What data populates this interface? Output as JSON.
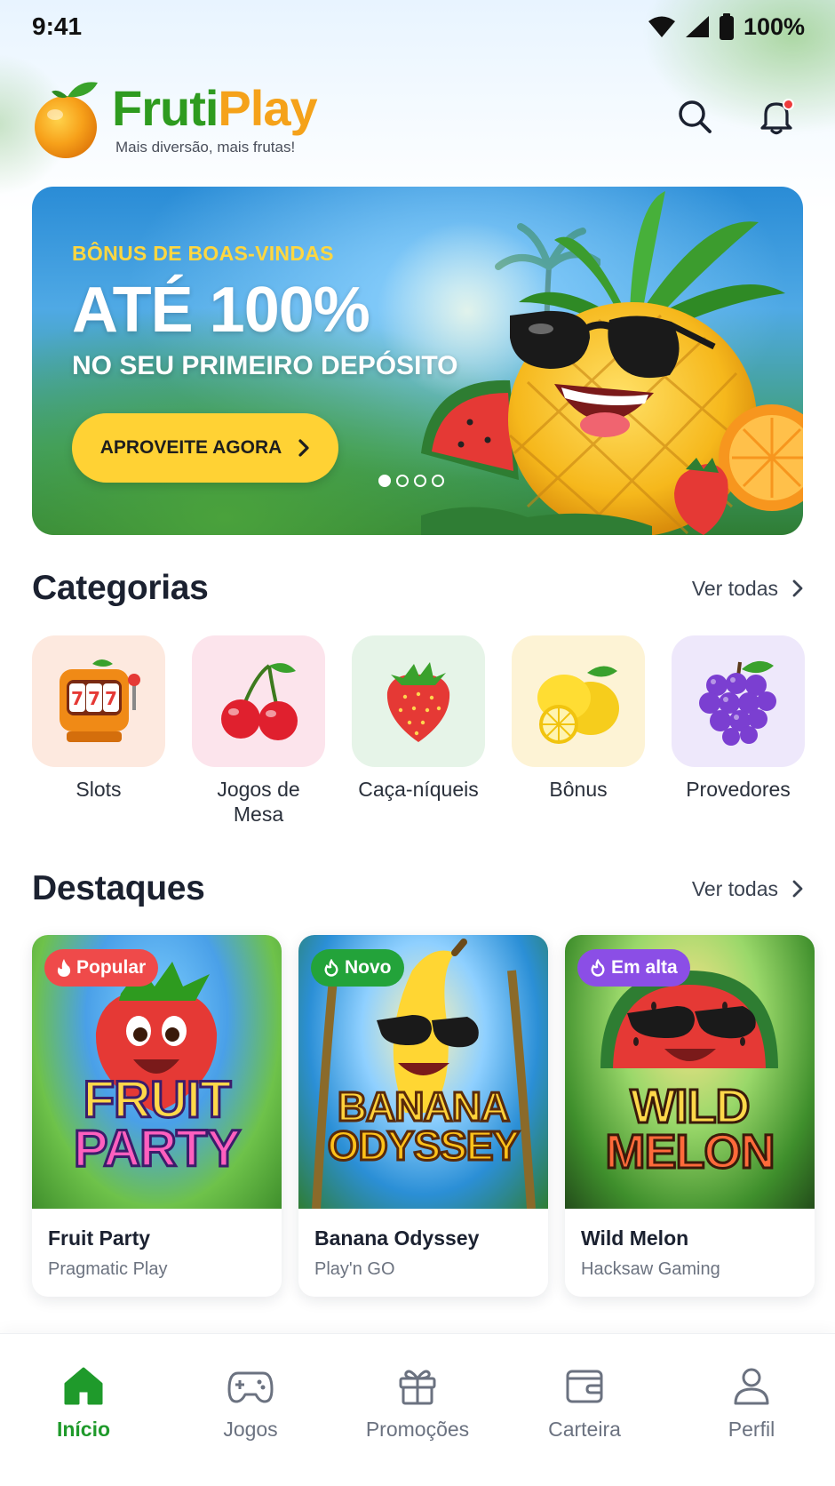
{
  "status_bar": {
    "time": "9:41",
    "battery": "100%"
  },
  "brand": {
    "name_part1": "Fruti",
    "name_part2": "Play",
    "tagline": "Mais diversão, mais frutas!"
  },
  "header": {
    "icons": [
      "search-icon",
      "bell-icon"
    ]
  },
  "banner": {
    "eyebrow": "BÔNUS DE BOAS-VINDAS",
    "title": "ATÉ 100%",
    "subtitle": "NO SEU PRIMEIRO DEPÓSITO",
    "cta": "APROVEITE AGORA",
    "slides": 4,
    "active_slide": 1
  },
  "categories": {
    "title": "Categorias",
    "see_all": "Ver todas",
    "items": [
      {
        "label": "Slots",
        "icon": "slot-machine-icon",
        "bg": "#fde9df"
      },
      {
        "label": "Jogos de Mesa",
        "icon": "cherries-icon",
        "bg": "#fce4ec"
      },
      {
        "label": "Caça-níqueis",
        "icon": "strawberry-icon",
        "bg": "#e6f4e8"
      },
      {
        "label": "Bônus",
        "icon": "lemon-icon",
        "bg": "#fdf3d5"
      },
      {
        "label": "Provedores",
        "icon": "grapes-icon",
        "bg": "#eee8fb"
      }
    ]
  },
  "featured": {
    "title": "Destaques",
    "see_all": "Ver todas",
    "games": [
      {
        "badge": "Popular",
        "title": "Fruit Party",
        "provider": "Pragmatic Play",
        "logo_line1": "FRUIT",
        "logo_line2": "PARTY"
      },
      {
        "badge": "Novo",
        "title": "Banana Odyssey",
        "provider": "Play'n GO",
        "logo_line1": "BANANA",
        "logo_line2": "ODYSSEY"
      },
      {
        "badge": "Em alta",
        "title": "Wild Melon",
        "provider": "Hacksaw Gaming",
        "logo_line1": "WILD",
        "logo_line2": "MELON"
      }
    ]
  },
  "bottom_nav": {
    "active": "Início",
    "items": [
      {
        "label": "Início",
        "icon": "home-icon"
      },
      {
        "label": "Jogos",
        "icon": "gamepad-icon"
      },
      {
        "label": "Promoções",
        "icon": "gift-icon"
      },
      {
        "label": "Carteira",
        "icon": "wallet-icon"
      },
      {
        "label": "Perfil",
        "icon": "user-icon"
      }
    ]
  },
  "colors": {
    "brand_green": "#2e9b1f",
    "brand_orange": "#f5a21a",
    "cta_yellow": "#ffd234",
    "nav_active": "#1f9a2b"
  }
}
